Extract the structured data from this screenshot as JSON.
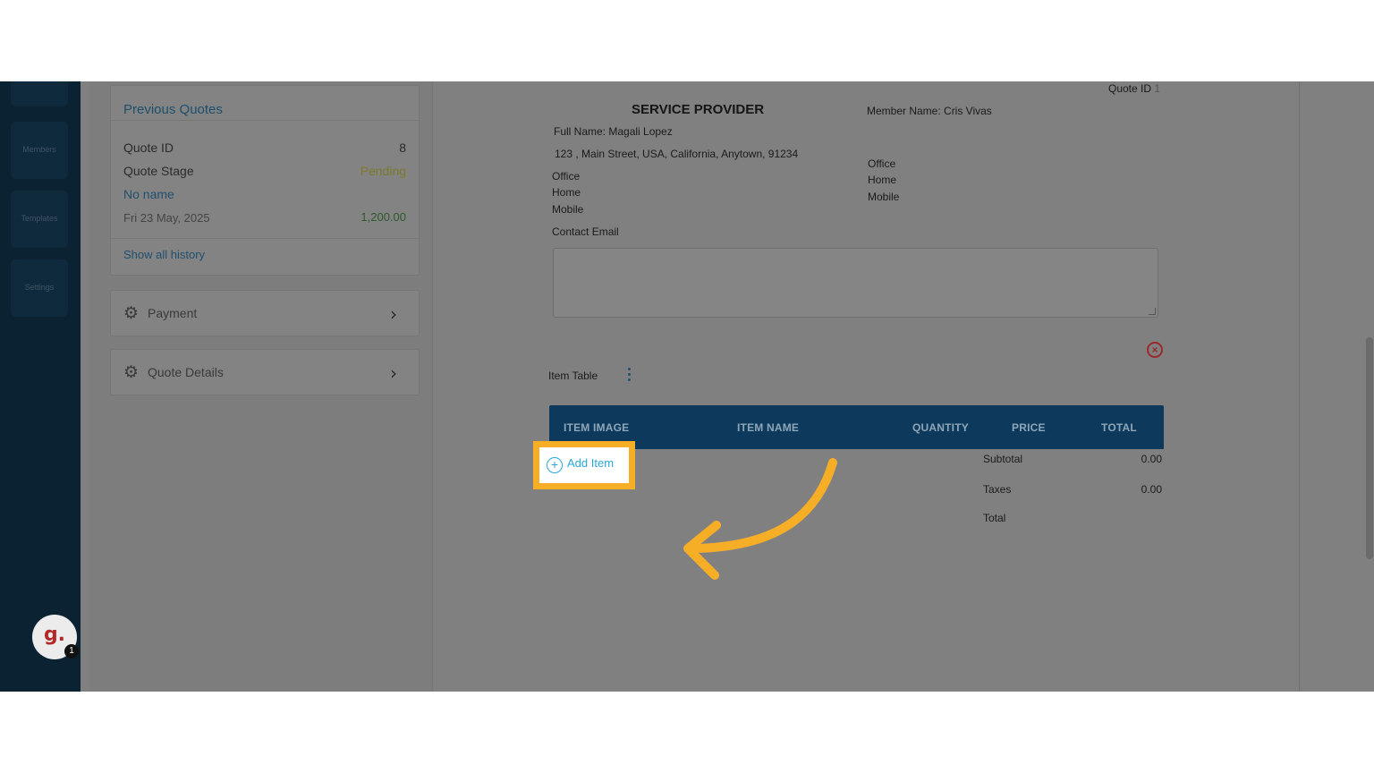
{
  "nav": {
    "items": [
      "Members",
      "Templates",
      "Settings"
    ],
    "avatar_letter": "g.",
    "avatar_badge": "1"
  },
  "previous_quotes": {
    "title": "Previous Quotes",
    "quote_id_label": "Quote ID",
    "quote_id_value": "8",
    "quote_stage_label": "Quote Stage",
    "quote_stage_value": "Pending",
    "name": "No name",
    "date": "Fri 23 May, 2025",
    "amount": "1,200.00",
    "history_link": "Show all history"
  },
  "accordions": {
    "payment": "Payment",
    "quote_details": "Quote Details"
  },
  "doc": {
    "quote_id_label": "Quote ID",
    "quote_id_value": "1",
    "service_provider_title": "SERVICE PROVIDER",
    "member_name": "Member Name: Cris Vivas",
    "full_name": "Full Name:  Magali Lopez",
    "address": "123 , Main Street, USA, California, Anytown, 91234",
    "provider_phones": [
      "Office",
      "Home",
      "Mobile"
    ],
    "member_phones": [
      "Office",
      "Home",
      "Mobile"
    ],
    "contact_email_label": "Contact Email",
    "contact_email_value": ""
  },
  "item_table": {
    "label": "Item Table",
    "columns": [
      "ITEM IMAGE",
      "ITEM NAME",
      "QUANTITY",
      "PRICE",
      "TOTAL"
    ],
    "add_item_label": "Add Item",
    "subtotal_label": "Subtotal",
    "subtotal_value": "0.00",
    "taxes_label": "Taxes",
    "taxes_value": "0.00",
    "total_label": "Total"
  },
  "colors": {
    "highlight": "#f7ae27",
    "accent": "#2aa7d9",
    "header": "#0d3a5c",
    "nav": "#0b2232"
  }
}
